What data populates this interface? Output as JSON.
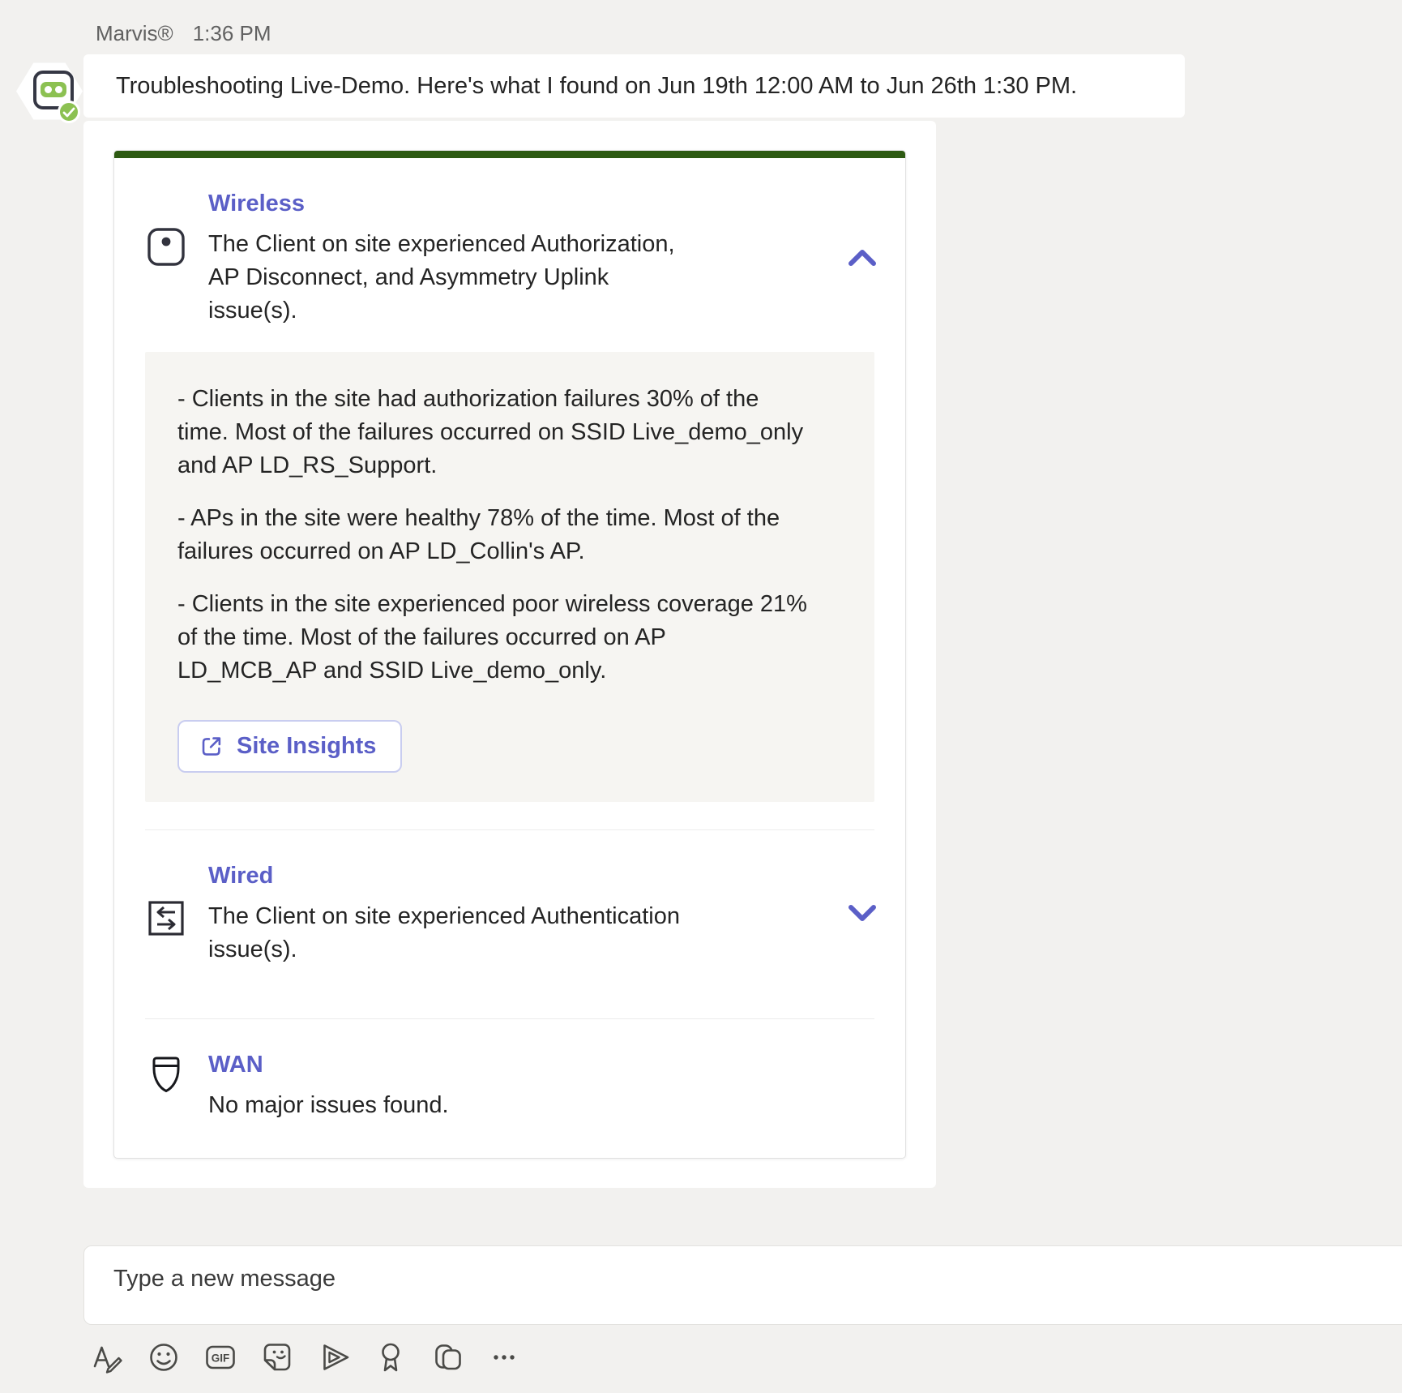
{
  "header": {
    "sender": "Marvis®",
    "time": "1:36 PM"
  },
  "intro_message": "Troubleshooting Live-Demo. Here's what I found on Jun 19th 12:00 AM to Jun 26th 1:30 PM.",
  "colors": {
    "accent_green": "#2d5a12",
    "brand_purple": "#5b5fc7",
    "avatar_green": "#8cc152"
  },
  "card": {
    "wireless": {
      "title": "Wireless",
      "summary_lines": [
        "The Client on site experienced Authorization,",
        "AP Disconnect, and Asymmetry Uplink",
        "issue(s)."
      ],
      "details": {
        "bullets": [
          {
            "lines": [
              "- Clients in the site had authorization failures 30% of the",
              "time. Most of the failures occurred on SSID Live_demo_only",
              "and AP LD_RS_Support."
            ]
          },
          {
            "lines": [
              "- APs in the site were healthy 78% of the time. Most of the",
              "failures occurred on AP LD_Collin's AP."
            ]
          },
          {
            "lines": [
              "- Clients in the site experienced poor wireless coverage 21%",
              "of the time. Most of the failures occurred on AP",
              "LD_MCB_AP and SSID Live_demo_only."
            ]
          }
        ],
        "button_label": "Site Insights"
      }
    },
    "wired": {
      "title": "Wired",
      "summary_lines": [
        "The Client on site experienced Authentication",
        "issue(s)."
      ]
    },
    "wan": {
      "title": "WAN",
      "summary_lines": [
        "No major issues found."
      ]
    }
  },
  "composer": {
    "placeholder": "Type a new message"
  },
  "toolbar": {
    "gif_label": "GIF",
    "icons": [
      "format",
      "emoji",
      "gif",
      "sticker",
      "stream",
      "praise",
      "updates",
      "more-options"
    ]
  }
}
